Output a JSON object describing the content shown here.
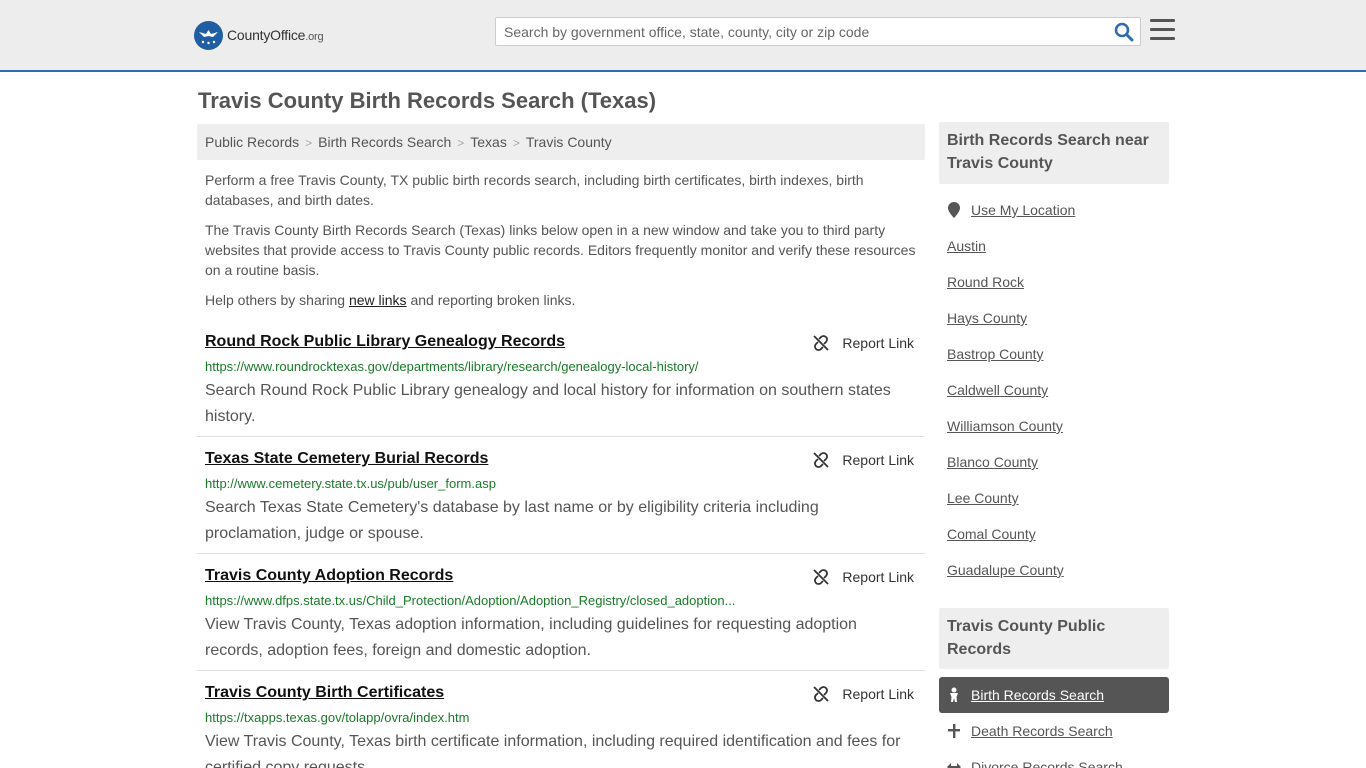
{
  "site": {
    "logo_main": "CountyOffice",
    "logo_tld": ".org"
  },
  "search": {
    "placeholder": "Search by government office, state, county, city or zip code"
  },
  "page_title": "Travis County Birth Records Search (Texas)",
  "breadcrumb": [
    "Public Records",
    "Birth Records Search",
    "Texas",
    "Travis County"
  ],
  "intro": {
    "p1": "Perform a free Travis County, TX public birth records search, including birth certificates, birth indexes, birth databases, and birth dates.",
    "p2": "The Travis County Birth Records Search (Texas) links below open in a new window and take you to third party websites that provide access to Travis County public records. Editors frequently monitor and verify these resources on a routine basis.",
    "p3_before": "Help others by sharing ",
    "p3_link": "new links",
    "p3_after": " and reporting broken links."
  },
  "report_label": "Report Link",
  "results": [
    {
      "title": "Round Rock Public Library Genealogy Records",
      "url": "https://www.roundrocktexas.gov/departments/library/research/genealogy-local-history/",
      "desc": "Search Round Rock Public Library genealogy and local history for information on southern states history."
    },
    {
      "title": "Texas State Cemetery Burial Records",
      "url": "http://www.cemetery.state.tx.us/pub/user_form.asp",
      "desc": "Search Texas State Cemetery's database by last name or by eligibility criteria including proclamation, judge or spouse."
    },
    {
      "title": "Travis County Adoption Records",
      "url": "https://www.dfps.state.tx.us/Child_Protection/Adoption/Adoption_Registry/closed_adoption...",
      "desc": "View Travis County, Texas adoption information, including guidelines for requesting adoption records, adoption fees, foreign and domestic adoption."
    },
    {
      "title": "Travis County Birth Certificates",
      "url": "https://txapps.texas.gov/tolapp/ovra/index.htm",
      "desc": "View Travis County, Texas birth certificate information, including required identification and fees for certified copy requests."
    }
  ],
  "sidebar": {
    "nearby_title": "Birth Records Search near Travis County",
    "use_location": "Use My Location",
    "nearby": [
      "Austin",
      "Round Rock",
      "Hays County",
      "Bastrop County",
      "Caldwell County",
      "Williamson County",
      "Blanco County",
      "Lee County",
      "Comal County",
      "Guadalupe County"
    ],
    "public_title": "Travis County Public Records",
    "public_items": [
      "Birth Records Search",
      "Death Records Search",
      "Divorce Records Search"
    ]
  }
}
